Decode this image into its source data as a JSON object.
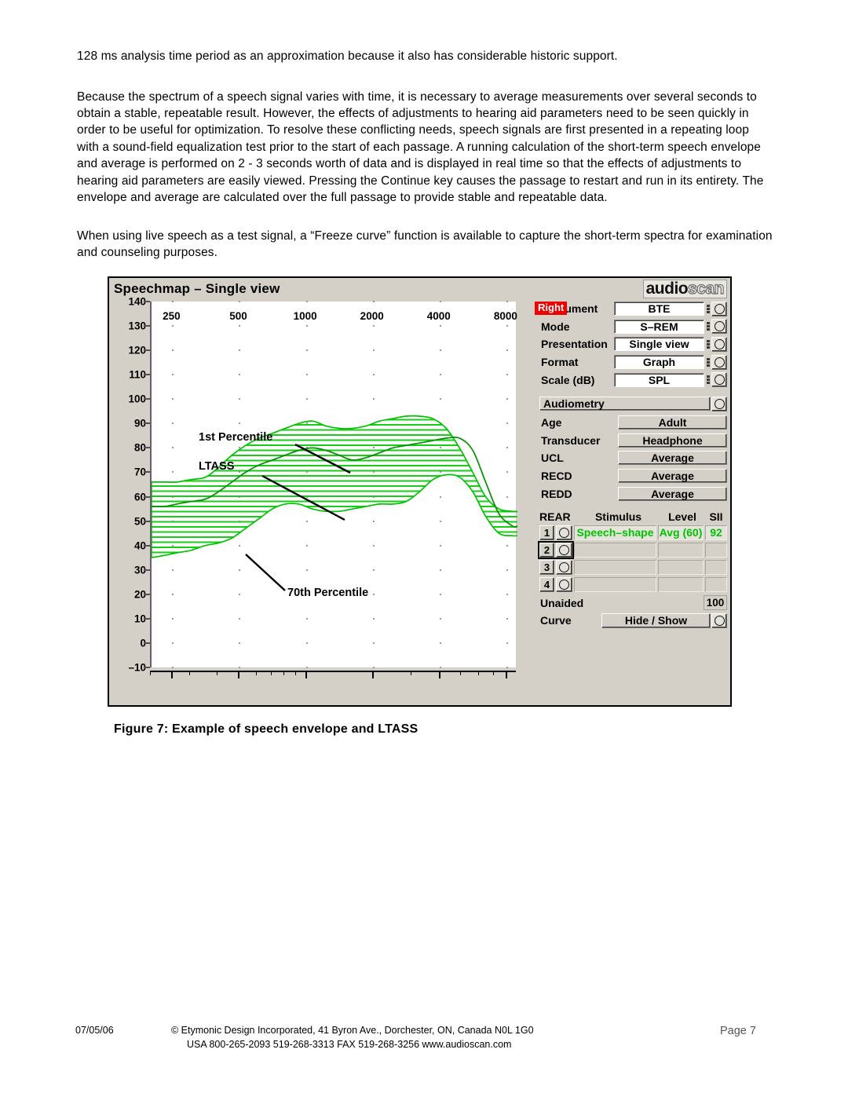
{
  "document": {
    "paragraphs": [
      "128 ms analysis time period as an approximation because it also has considerable historic support.",
      "Because the spectrum of a speech signal varies with time, it is necessary to average measurements over several seconds to obtain a stable, repeatable result.  However, the effects of adjustments to hearing aid parameters need to be seen quickly in order to be useful for optimization.  To resolve these conflicting needs, speech signals are first presented in a repeating loop with a sound-field equalization test prior to the start of each passage.  A running calculation of the short-term speech envelope and average is performed on 2 - 3 seconds worth of data and is displayed in real time so that the effects of adjustments to hearing aid parameters are easily viewed.  Pressing the Continue key causes the passage to restart and run in its entirety.  The envelope and average are calculated over the full passage to provide stable and repeatable data.",
      "When using live speech as a test signal, a “Freeze curve” function is available to capture the short-term spectra for examination and counseling purposes."
    ],
    "caption": "Figure 7:  Example of speech envelope and LTASS",
    "footer": {
      "date": "07/05/06",
      "copyright_line1": "© Etymonic Design Incorporated, 41 Byron Ave., Dorchester, ON, Canada  N0L 1G0",
      "copyright_line2": "USA 800-265-2093  519-268-3313  FAX 519-268-3256  www.audioscan.com",
      "page": "Page 7"
    }
  },
  "device": {
    "title": "Speechmap – Single view",
    "logo_part1": "audio",
    "logo_part2": "scan",
    "ear_badge": "Right",
    "ear_badge_color": "#ee0000",
    "accent_green": "#00c400",
    "settings": [
      {
        "label": "Instrument",
        "value": "BTE",
        "icon": "spinner-grip-icon",
        "knob": "rotary-knob-icon"
      },
      {
        "label": "Mode",
        "value": "S–REM",
        "icon": "spinner-grip-icon",
        "knob": "rotary-knob-icon"
      },
      {
        "label": "Presentation",
        "value": "Single view",
        "icon": "spinner-grip-icon",
        "knob": "rotary-knob-icon"
      },
      {
        "label": "Format",
        "value": "Graph",
        "icon": "spinner-grip-icon",
        "knob": "rotary-knob-icon"
      },
      {
        "label": "Scale (dB)",
        "value": "SPL",
        "icon": "spinner-grip-icon",
        "knob": "rotary-knob-icon"
      }
    ],
    "audiometry": {
      "header": "Audiometry",
      "rows": [
        {
          "label": "Age",
          "value": "Adult"
        },
        {
          "label": "Transducer",
          "value": "Headphone"
        },
        {
          "label": "UCL",
          "value": "Average"
        },
        {
          "label": "RECD",
          "value": "Average"
        },
        {
          "label": "REDD",
          "value": "Average"
        }
      ]
    },
    "rear": {
      "headers": [
        "REAR",
        "Stimulus",
        "Level",
        "SII"
      ],
      "rows": [
        {
          "num": "1",
          "stimulus": "Speech–shape",
          "level": "Avg (60)",
          "sii": "92",
          "active": true,
          "selected": false
        },
        {
          "num": "2",
          "stimulus": "",
          "level": "",
          "sii": "",
          "active": false,
          "selected": true
        },
        {
          "num": "3",
          "stimulus": "",
          "level": "",
          "sii": "",
          "active": false,
          "selected": false
        },
        {
          "num": "4",
          "stimulus": "",
          "level": "",
          "sii": "",
          "active": false,
          "selected": false
        }
      ],
      "unaided_label": "Unaided",
      "unaided_value": "100",
      "curve_label": "Curve",
      "curve_button": "Hide / Show"
    }
  },
  "chart_data": {
    "type": "area",
    "title": "Speechmap – Single view",
    "xlabel": "",
    "ylabel": "",
    "xscale": "log",
    "xlim": [
      200,
      8900
    ],
    "ylim": [
      -10,
      140
    ],
    "ytick_step": 10,
    "yticks": [
      140,
      130,
      120,
      110,
      100,
      90,
      80,
      70,
      60,
      50,
      40,
      30,
      20,
      10,
      0,
      -10
    ],
    "xticks": [
      250,
      500,
      1000,
      2000,
      4000,
      8000
    ],
    "xticklabels": [
      "250",
      "500",
      "1000",
      "2000",
      "4000",
      "8000"
    ],
    "grid": "dots",
    "legend": "annotations",
    "annotations": [
      {
        "text": "1st Percentile",
        "x": 250,
        "y": 97
      },
      {
        "text": "LTASS",
        "x": 250,
        "y": 87
      },
      {
        "text": "70th Percentile",
        "x": 560,
        "y": 33
      }
    ],
    "series": [
      {
        "name": "1st Percentile",
        "color": "#00c400",
        "x": [
          200,
          230,
          260,
          300,
          350,
          400,
          460,
          530,
          610,
          700,
          800,
          920,
          1060,
          1220,
          1400,
          1610,
          1850,
          2130,
          2440,
          2800,
          3220,
          3700,
          4250,
          4880,
          5600,
          6400,
          7350,
          8450,
          8900
        ],
        "y": [
          66,
          66,
          66,
          67,
          68,
          72,
          77,
          81,
          84,
          86,
          88,
          90,
          91,
          89,
          88,
          88,
          89,
          91,
          92,
          93,
          93,
          92,
          88,
          80,
          70,
          60,
          55,
          54,
          54
        ]
      },
      {
        "name": "LTASS",
        "color": "#00a800",
        "x": [
          200,
          230,
          260,
          300,
          350,
          400,
          460,
          530,
          610,
          700,
          800,
          920,
          1060,
          1220,
          1400,
          1610,
          1850,
          2130,
          2440,
          2800,
          3220,
          3700,
          4250,
          4880,
          5600,
          6400,
          7350,
          8450,
          8900
        ],
        "y": [
          56,
          56,
          57,
          58,
          59,
          62,
          66,
          70,
          73,
          75,
          77,
          79,
          80,
          79,
          77,
          75,
          76,
          78,
          80,
          81,
          82,
          83,
          84,
          84,
          79,
          66,
          53,
          48,
          48
        ]
      },
      {
        "name": "70th Percentile",
        "color": "#00c400",
        "x": [
          200,
          230,
          260,
          300,
          350,
          400,
          460,
          530,
          610,
          700,
          800,
          920,
          1060,
          1220,
          1400,
          1610,
          1850,
          2130,
          2440,
          2800,
          3220,
          3700,
          4250,
          4880,
          5600,
          6400,
          7350,
          8450,
          8900
        ],
        "y": [
          35,
          36,
          37,
          38,
          40,
          41,
          43,
          47,
          51,
          55,
          57,
          57,
          55,
          54,
          54,
          55,
          56,
          57,
          57,
          58,
          62,
          67,
          69,
          68,
          62,
          52,
          45,
          44,
          44
        ]
      }
    ]
  }
}
